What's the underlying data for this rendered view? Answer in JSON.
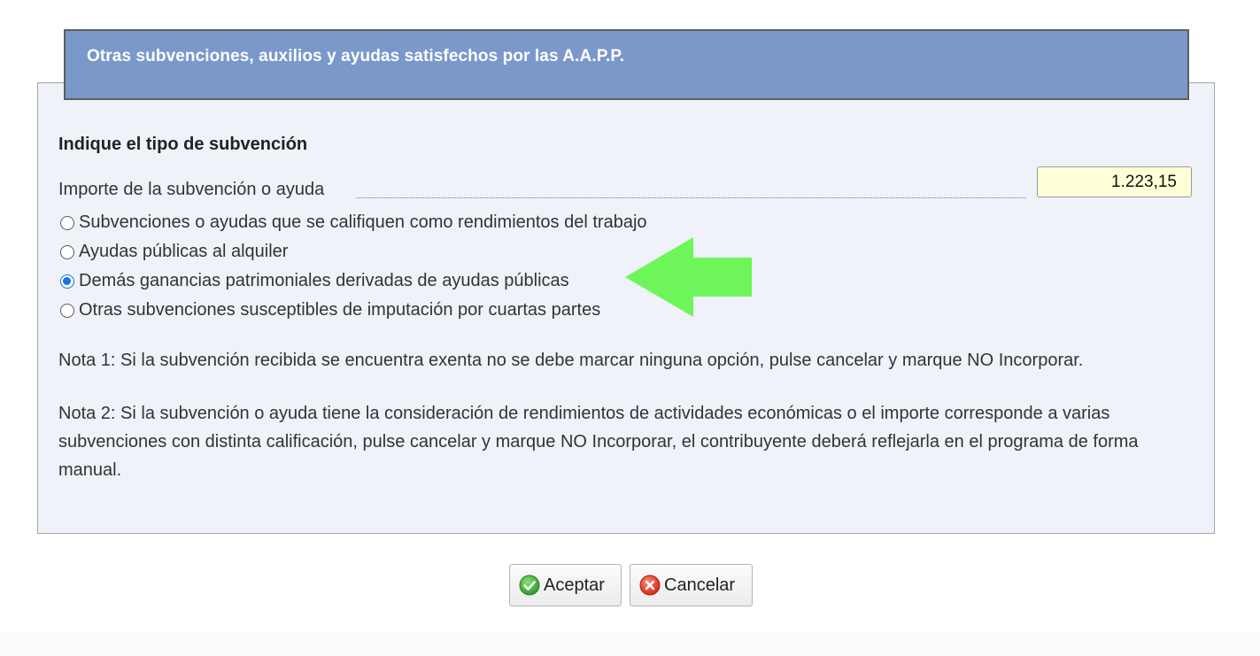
{
  "dialog": {
    "title": "Otras subvenciones, auxilios y ayudas satisfechos por las A.A.P.P.",
    "section_title": "Indique el tipo de subvención",
    "amount_label": "Importe de la subvención o ayuda",
    "amount_value": "1.223,15",
    "options": [
      {
        "label": "Subvenciones o ayudas que se califiquen como rendimientos del trabajo",
        "checked": false
      },
      {
        "label": "Ayudas públicas al alquiler",
        "checked": false
      },
      {
        "label": "Demás ganancias patrimoniales derivadas de ayudas públicas",
        "checked": true
      },
      {
        "label": "Otras subvenciones susceptibles de imputación por cuartas partes",
        "checked": false
      }
    ],
    "note1": "Nota 1: Si la subvención recibida se encuentra exenta no se debe marcar ninguna opción, pulse cancelar y marque NO Incorporar.",
    "note2": "Nota 2: Si la subvención o ayuda tiene la consideración de rendimientos de actividades económicas o el importe corresponde a varias subvenciones con distinta calificación, pulse cancelar y marque NO Incorporar, el contribuyente deberá reflejarla en el programa de forma manual."
  },
  "buttons": {
    "accept_label": "Aceptar",
    "cancel_label": "Cancelar"
  },
  "icons": {
    "accept": "check-circle-icon",
    "cancel": "x-circle-icon",
    "annotation": "arrow-left-icon"
  },
  "colors": {
    "header_bg": "#7b98cb",
    "panel_bg": "#eff2f9",
    "input_bg": "#ffffd8",
    "arrow": "#6ef55a",
    "radio_checked": "#1a73e8"
  }
}
